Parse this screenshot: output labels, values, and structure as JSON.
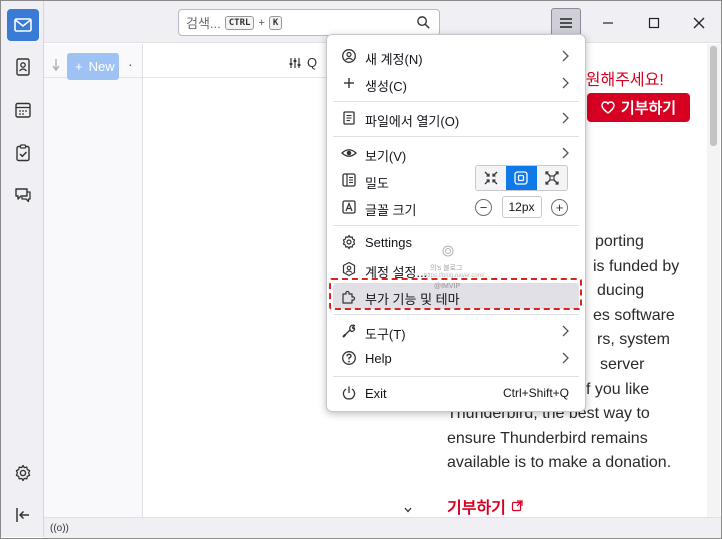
{
  "search": {
    "placeholder": "검색...",
    "shortcut_key1": "CTRL",
    "shortcut_plus": "+",
    "shortcut_key2": "K"
  },
  "folder_pane": {
    "new_button": "New"
  },
  "message_list": {
    "quick_filter_label": "Q"
  },
  "app_menu": {
    "items": [
      {
        "label": "새 계정(N)",
        "icon": "new-account-icon",
        "submenu": true
      },
      {
        "label": "생성(C)",
        "icon": "plus-icon",
        "submenu": true
      },
      {
        "label": "파일에서 열기(O)",
        "icon": "open-file-icon",
        "submenu": true
      },
      {
        "label": "보기(V)",
        "icon": "eye-icon",
        "submenu": true
      },
      {
        "label": "밀도",
        "icon": "density-icon",
        "submenu": false
      },
      {
        "label": "글꼴 크기",
        "icon": "font-size-icon",
        "submenu": false
      },
      {
        "label": "Settings",
        "icon": "gear-icon",
        "submenu": false
      },
      {
        "label": "계정 설정...",
        "icon": "account-settings-icon",
        "submenu": false
      },
      {
        "label": "부가 기능 및 테마",
        "icon": "puzzle-icon",
        "submenu": false,
        "highlighted": true
      },
      {
        "label": "도구(T)",
        "icon": "tools-icon",
        "submenu": true
      },
      {
        "label": "Help",
        "icon": "help-icon",
        "submenu": true
      },
      {
        "label": "Exit",
        "icon": "power-icon",
        "submenu": false,
        "shortcut": "Ctrl+Shift+Q"
      }
    ],
    "font_size_value": "12px"
  },
  "start_page": {
    "support_heading": "지원해주세요!",
    "donate_button": "기부하기",
    "body_lines": [
      "porting",
      "is funded by",
      "ducing",
      "es software",
      "rs, system",
      "server",
      "f you like",
      "Thunderbird, the best way to",
      "ensure Thunderbird remains",
      "available is to make a donation."
    ],
    "donate_link": "기부하기"
  },
  "watermark": {
    "line1": "의's 블로그",
    "line2": "https://blog.naver.com/...",
    "line3": "@IMVIP"
  },
  "statusbar": {
    "indicator": "((o))"
  },
  "colors": {
    "accent": "#0f79e8",
    "brand_red": "#d70022",
    "highlight_border": "#d9261c"
  }
}
